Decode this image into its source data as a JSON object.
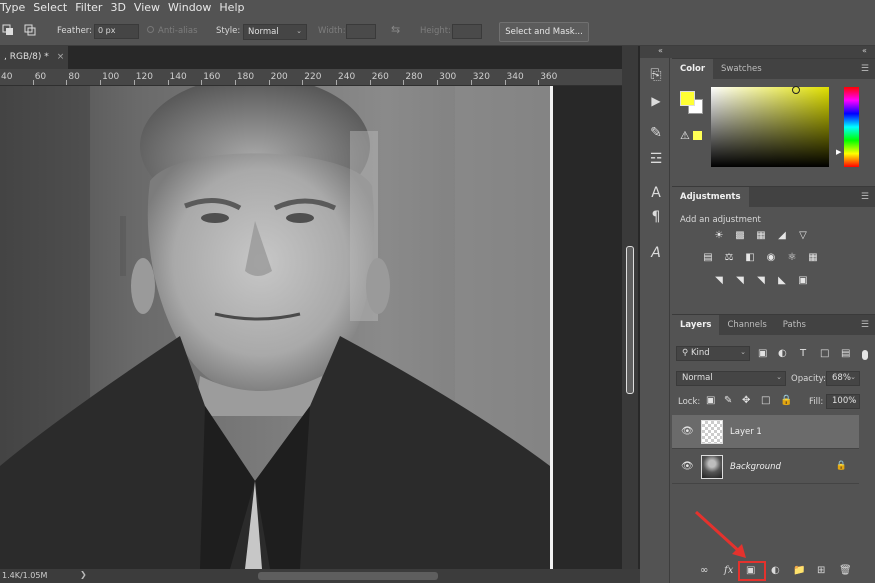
{
  "menu": [
    "Type",
    "Select",
    "Filter",
    "3D",
    "View",
    "Window",
    "Help"
  ],
  "options": {
    "feather_label": "Feather:",
    "feather_value": "0 px",
    "antialias_label": "Anti-alias",
    "style_label": "Style:",
    "style_value": "Normal",
    "width_label": "Width:",
    "height_label": "Height:",
    "select_mask_label": "Select and Mask..."
  },
  "document": {
    "tab_title": ", RGB/8) *",
    "tab_close": "×",
    "status": "1.4K/1.05M",
    "ruler_ticks": [
      "40",
      "60",
      "80",
      "100",
      "120",
      "140",
      "160",
      "180",
      "200",
      "220",
      "240",
      "260",
      "280",
      "300",
      "320",
      "340",
      "360"
    ]
  },
  "color_panel": {
    "tabs": [
      "Color",
      "Swatches"
    ],
    "active_tab": "Color",
    "foreground_color": "#ffff33",
    "background_color": "#ffffff"
  },
  "adjustments": {
    "title": "Adjustments",
    "subtitle": "Add an adjustment"
  },
  "layers_panel": {
    "tabs": [
      "Layers",
      "Channels",
      "Paths"
    ],
    "active_tab": "Layers",
    "filter_kind": "Kind",
    "blend_mode": "Normal",
    "opacity_label": "Opacity:",
    "opacity_value": "68%",
    "lock_label": "Lock:",
    "fill_label": "Fill:",
    "fill_value": "100%",
    "layers": [
      {
        "name": "Layer 1",
        "selected": true,
        "thumb": "transparent"
      },
      {
        "name": "Background",
        "selected": false,
        "thumb": "photo",
        "locked": true
      }
    ],
    "fx_label": "fx"
  },
  "annotation": {
    "highlight_color": "#e4322d",
    "arrow_color": "#e4322d"
  }
}
